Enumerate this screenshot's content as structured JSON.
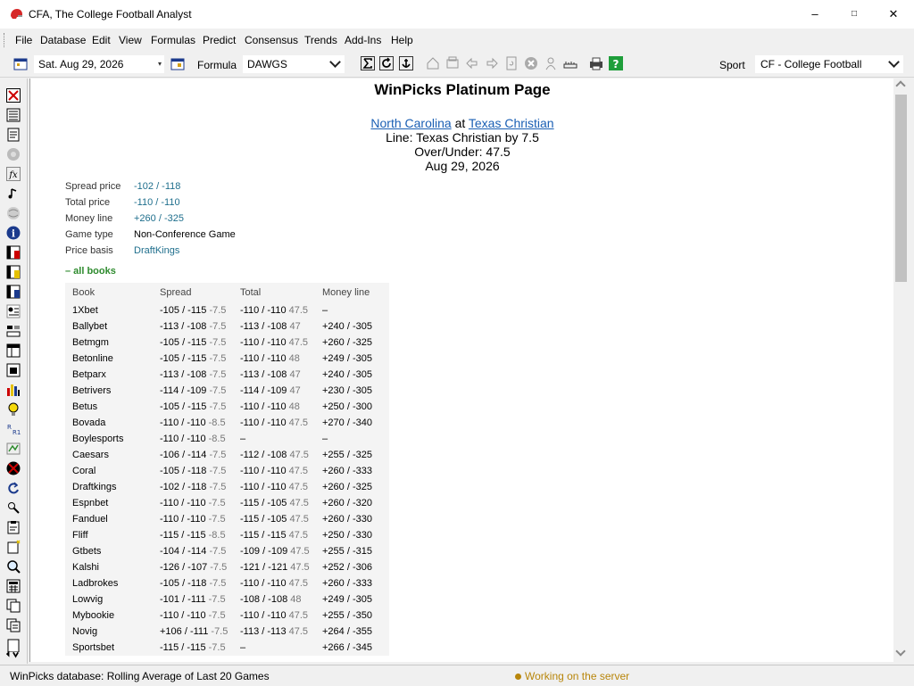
{
  "window": {
    "title": "CFA, The College Football Analyst",
    "minimize": "–",
    "maximize": "□",
    "close": "✕"
  },
  "menu": [
    "File",
    "Database",
    "Edit",
    "View",
    "Formulas",
    "Predict",
    "Consensus",
    "Trends",
    "Add-Ins",
    "Help"
  ],
  "toolbar": {
    "date_value": "Sat. Aug 29, 2026",
    "formula_label": "Formula",
    "formula_value": "DAWGS",
    "sport_label": "Sport",
    "sport_value": "CF - College Football"
  },
  "page": {
    "title": "WinPicks Platinum Page",
    "away_team": "North Carolina",
    "at": "at",
    "home_team": "Texas Christian",
    "line_text": "Line: Texas Christian by 7.5",
    "over_under": "Over/Under: 47.5",
    "date": "Aug 29, 2026"
  },
  "details": [
    {
      "label": "Spread price",
      "value": "-102 / -118",
      "link": true
    },
    {
      "label": "Total price",
      "value": "-110 / -110",
      "link": true
    },
    {
      "label": "Money line",
      "value": "+260 / -325",
      "link": true
    },
    {
      "label": "Game type",
      "value": "Non-Conference Game",
      "link": false
    },
    {
      "label": "Price basis",
      "value": "DraftKings",
      "link": true
    }
  ],
  "all_books_label": "– all books",
  "table": {
    "headers": [
      "Book",
      "Spread",
      "Total",
      "Money line"
    ],
    "rows": [
      [
        "1Xbet",
        "-105 / -115",
        "-7.5",
        "-110 / -110",
        "47.5",
        "–"
      ],
      [
        "Ballybet",
        "-113 / -108",
        "-7.5",
        "-113 / -108",
        "47",
        "+240 / -305"
      ],
      [
        "Betmgm",
        "-105 / -115",
        "-7.5",
        "-110 / -110",
        "47.5",
        "+260 / -325"
      ],
      [
        "Betonline",
        "-105 / -115",
        "-7.5",
        "-110 / -110",
        "48",
        "+249 / -305"
      ],
      [
        "Betparx",
        "-113 / -108",
        "-7.5",
        "-113 / -108",
        "47",
        "+240 / -305"
      ],
      [
        "Betrivers",
        "-114 / -109",
        "-7.5",
        "-114 / -109",
        "47",
        "+230 / -305"
      ],
      [
        "Betus",
        "-105 / -115",
        "-7.5",
        "-110 / -110",
        "48",
        "+250 / -300"
      ],
      [
        "Bovada",
        "-110 / -110",
        "-8.5",
        "-110 / -110",
        "47.5",
        "+270 / -340"
      ],
      [
        "Boylesports",
        "-110 / -110",
        "-8.5",
        "–",
        "",
        "–"
      ],
      [
        "Caesars",
        "-106 / -114",
        "-7.5",
        "-112 / -108",
        "47.5",
        "+255 / -325"
      ],
      [
        "Coral",
        "-105 / -118",
        "-7.5",
        "-110 / -110",
        "47.5",
        "+260 / -333"
      ],
      [
        "Draftkings",
        "-102 / -118",
        "-7.5",
        "-110 / -110",
        "47.5",
        "+260 / -325"
      ],
      [
        "Espnbet",
        "-110 / -110",
        "-7.5",
        "-115 / -105",
        "47.5",
        "+260 / -320"
      ],
      [
        "Fanduel",
        "-110 / -110",
        "-7.5",
        "-115 / -105",
        "47.5",
        "+260 / -330"
      ],
      [
        "Fliff",
        "-115 / -115",
        "-8.5",
        "-115 / -115",
        "47.5",
        "+250 / -330"
      ],
      [
        "Gtbets",
        "-104 / -114",
        "-7.5",
        "-109 / -109",
        "47.5",
        "+255 / -315"
      ],
      [
        "Kalshi",
        "-126 / -107",
        "-7.5",
        "-121 / -121",
        "47.5",
        "+252 / -306"
      ],
      [
        "Ladbrokes",
        "-105 / -118",
        "-7.5",
        "-110 / -110",
        "47.5",
        "+260 / -333"
      ],
      [
        "Lowvig",
        "-101 / -111",
        "-7.5",
        "-108 / -108",
        "48",
        "+249 / -305"
      ],
      [
        "Mybookie",
        "-110 / -110",
        "-7.5",
        "-110 / -110",
        "47.5",
        "+255 / -350"
      ],
      [
        "Novig",
        "+106 / -111",
        "-7.5",
        "-113 / -113",
        "47.5",
        "+264 / -355"
      ],
      [
        "Sportsbet",
        "-115 / -115",
        "-7.5",
        "–",
        "",
        "+266 / -345"
      ]
    ]
  },
  "status": {
    "left": "WinPicks database:  Rolling Average of Last 20 Games",
    "right": "Working on the server"
  },
  "colors": {
    "link": "#1a5fb4",
    "green": "#2e8b2e",
    "status": "#b8860b"
  }
}
